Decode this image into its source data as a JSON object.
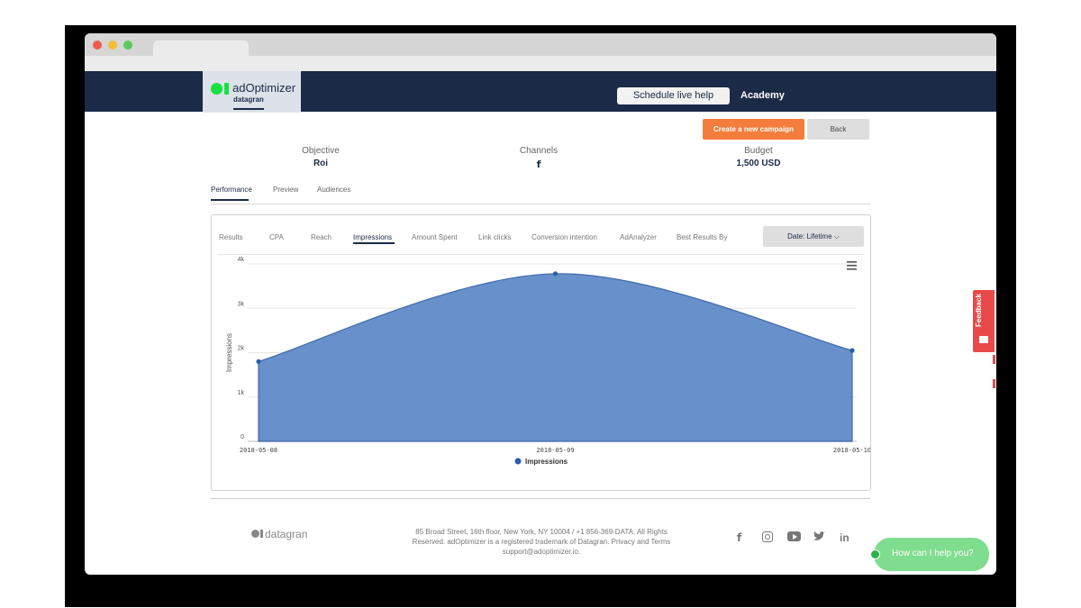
{
  "brand": {
    "name": "adOptimizer",
    "sub": "datagran"
  },
  "header": {
    "schedule_label": "Schedule live help",
    "academy_label": "Academy"
  },
  "actions": {
    "create_label": "Create a new campaign",
    "back_label": "Back"
  },
  "summary": {
    "objective": {
      "label": "Objective",
      "value": "Roi"
    },
    "channels": {
      "label": "Channels",
      "value": "f"
    },
    "budget": {
      "label": "Budget",
      "value": "1,500 USD"
    }
  },
  "sub_tabs": [
    "Performance",
    "Preview",
    "Audiences"
  ],
  "metric_tabs": [
    "Results",
    "CPA",
    "Reach",
    "Impressions",
    "Amount Spent",
    "Link clicks",
    "Conversion intention",
    "AdAnalyzer",
    "Best Results By"
  ],
  "date_filter": "Date: Lifetime",
  "chart_data": {
    "type": "area",
    "x": [
      "2018-05-08",
      "2018-05-09",
      "2018-05-10"
    ],
    "series": [
      {
        "name": "Impressions",
        "values": [
          1800,
          3780,
          2050
        ],
        "color": "#5b87c5"
      }
    ],
    "ylabel": "Impressions",
    "yticks": [
      "0",
      "1k",
      "2k",
      "3k",
      "4k"
    ],
    "ylim": [
      0,
      4000
    ],
    "grid": true,
    "legend": "bottom-center"
  },
  "footer": {
    "logo_text": "datagran",
    "address_line1": "85 Broad Street, 16th floor, New York, NY 10004 / +1 856-369-DATA. All Rights",
    "address_line2": "Reserved. adOptimizer is a registered trademark of Datagran. Privacy and Terms",
    "address_line3": "support@adoptimizer.io.",
    "social": [
      "facebook-icon",
      "instagram-icon",
      "youtube-icon",
      "twitter-icon",
      "linkedin-icon"
    ]
  },
  "feedback_label": "Feedback",
  "chat_label": "How can I help you?",
  "colors": {
    "header": "#1b2a47",
    "accent": "#f47c3c",
    "brand_green": "#17e23f",
    "chart_fill": "#5b87c5",
    "feedback": "#e84a4a",
    "chat": "#7fdd8f"
  }
}
